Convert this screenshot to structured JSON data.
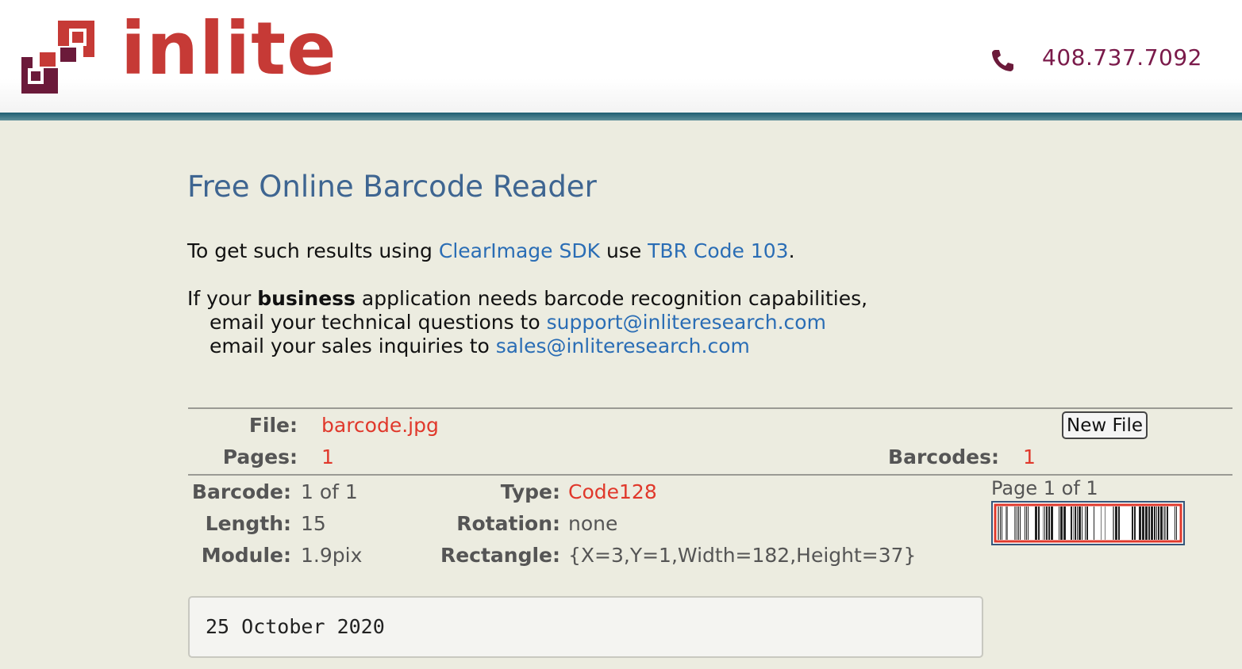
{
  "header": {
    "logo_text": "inlite",
    "phone": "408.737.7092",
    "icons": [
      "logo-squares-icon",
      "phone-icon"
    ],
    "colors": {
      "logo_red": "#c63a36",
      "logo_dark": "#6b1a3a",
      "phone": "#7a1a4a",
      "bar": "#2b6778"
    }
  },
  "main": {
    "title": "Free Online Barcode Reader",
    "sdk_line": {
      "prefix": "To get such results using ",
      "sdk_link": "ClearImage SDK",
      "middle": " use ",
      "tbr_link": "TBR Code 103",
      "suffix": "."
    },
    "business": {
      "prefix": "If your ",
      "bold": "business",
      "suffix": " application needs barcode recognition capabilities,",
      "support_prefix": "email your technical questions to ",
      "support_email": "support@inliteresearch.com",
      "sales_prefix": "email your sales inquiries to ",
      "sales_email": "sales@inliteresearch.com"
    }
  },
  "summary": {
    "file_label": "File:",
    "file_value": "barcode.jpg",
    "pages_label": "Pages:",
    "pages_value": "1",
    "barcodes_label": "Barcodes:",
    "barcodes_value": "1",
    "new_file_button": "New File"
  },
  "barcode": {
    "barcode_label": "Barcode:",
    "barcode_value": "1 of 1",
    "length_label": "Length:",
    "length_value": "15",
    "module_label": "Module:",
    "module_value": "1.9pix",
    "type_label": "Type:",
    "type_value": "Code128",
    "rotation_label": "Rotation:",
    "rotation_value": "none",
    "rectangle_label": "Rectangle:",
    "rectangle_value": "{X=3,Y=1,Width=182,Height=37}",
    "page_info": "Page 1 of 1",
    "result_text": "25 October 2020"
  }
}
